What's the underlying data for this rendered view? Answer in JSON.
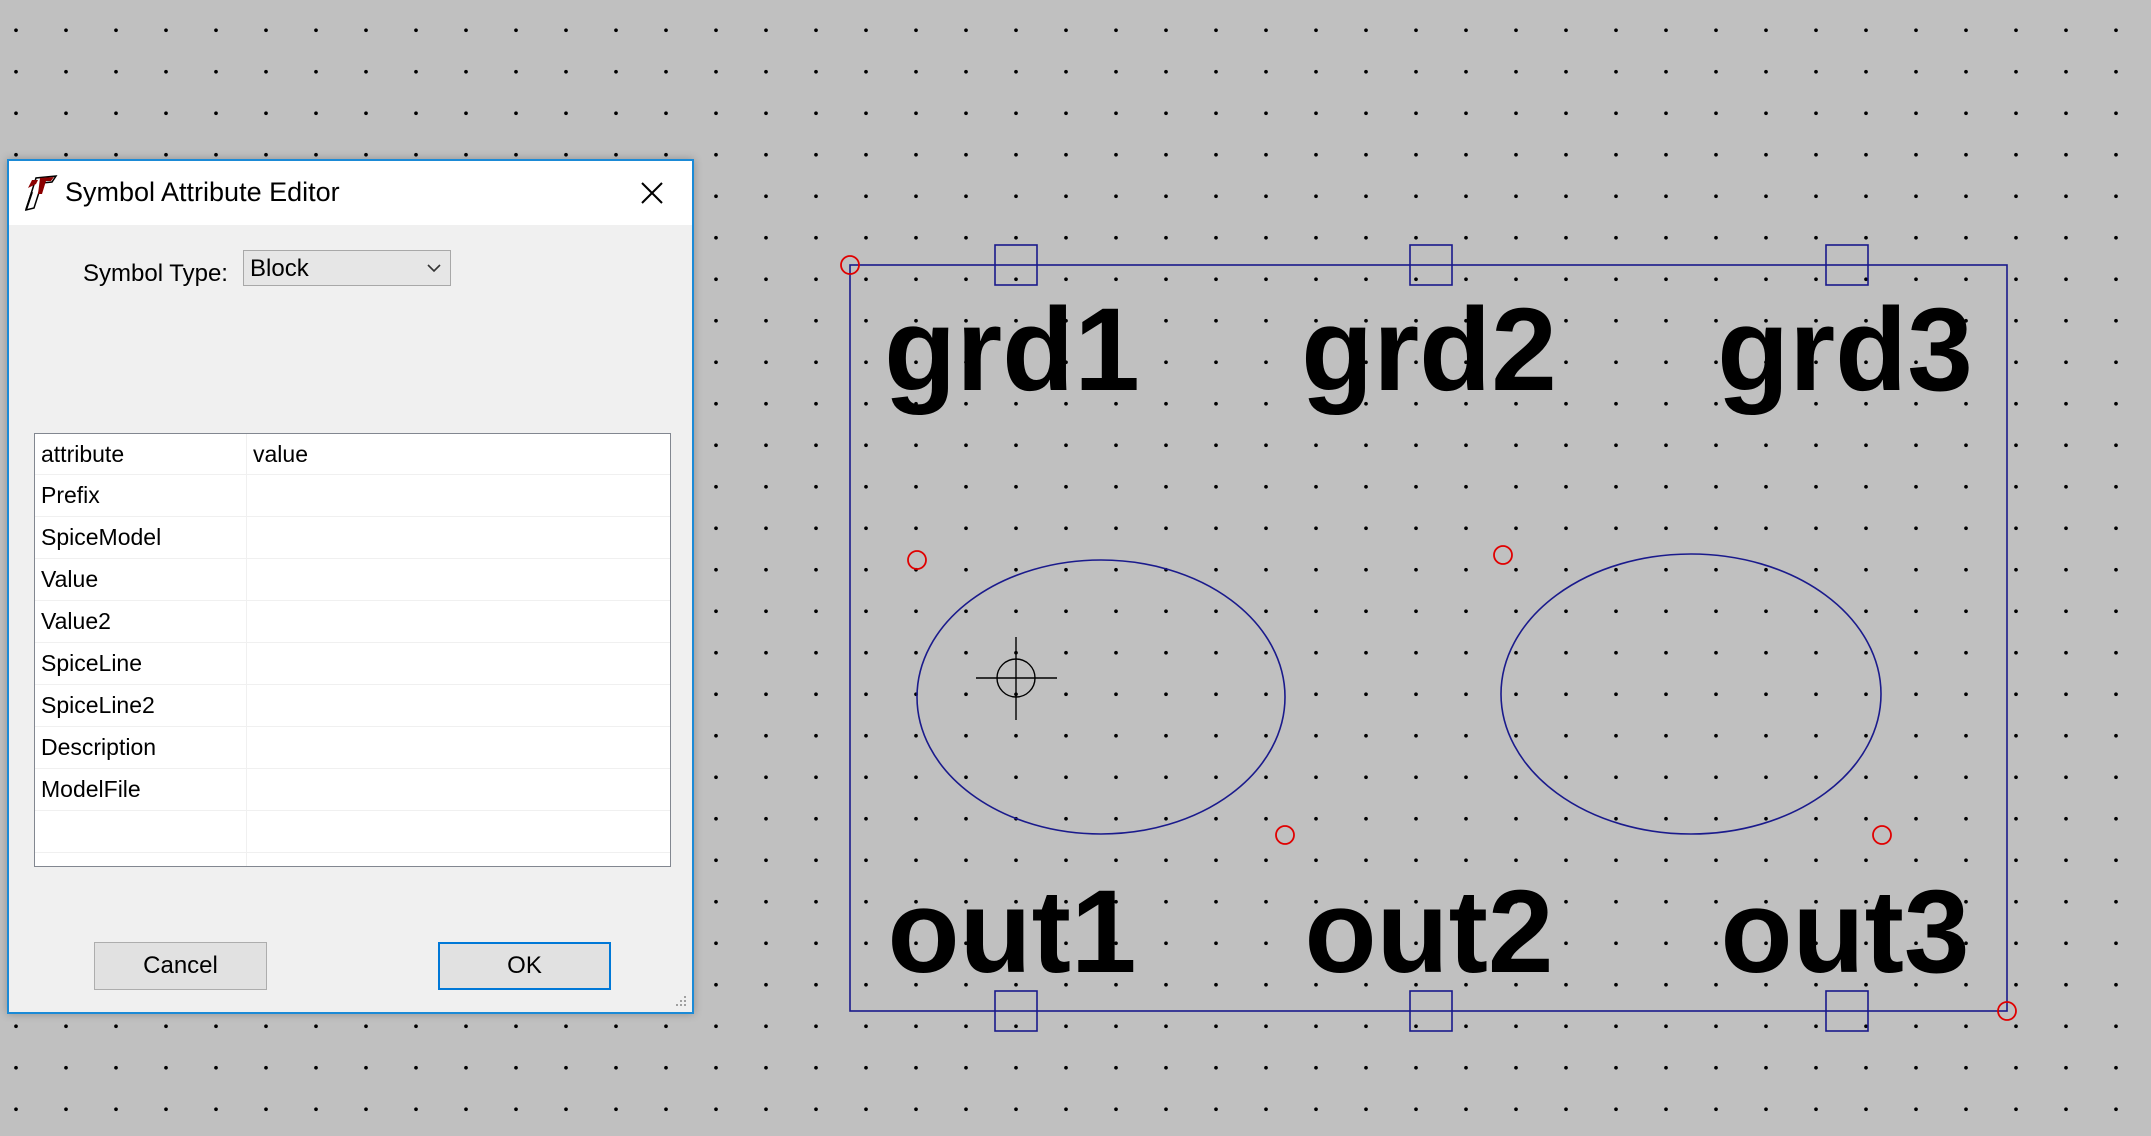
{
  "dialog": {
    "title": "Symbol Attribute Editor",
    "symbol_type_label": "Symbol Type:",
    "symbol_type_value": "Block",
    "table_header": {
      "attribute": "attribute",
      "value": "value"
    },
    "rows": [
      {
        "attribute": "Prefix",
        "value": ""
      },
      {
        "attribute": "SpiceModel",
        "value": ""
      },
      {
        "attribute": "Value",
        "value": ""
      },
      {
        "attribute": "Value2",
        "value": ""
      },
      {
        "attribute": "SpiceLine",
        "value": ""
      },
      {
        "attribute": "SpiceLine2",
        "value": ""
      },
      {
        "attribute": "Description",
        "value": ""
      },
      {
        "attribute": "ModelFile",
        "value": ""
      }
    ],
    "cancel_label": "Cancel",
    "ok_label": "OK"
  },
  "symbol": {
    "pins_top": [
      "grd1",
      "grd2",
      "grd3"
    ],
    "pins_bottom": [
      "out1",
      "out2",
      "out3"
    ]
  },
  "colors": {
    "canvas_bg": "#c0c0c0",
    "grid_dot": "#000000",
    "symbol_line": "#1a1a8c",
    "anchor_circle": "#e00000",
    "dialog_border": "#1b8ad6"
  },
  "icons": [
    "ltspice-logo-icon",
    "close-icon",
    "chevron-down-icon",
    "resize-grip-icon",
    "crosshair-cursor-icon"
  ]
}
